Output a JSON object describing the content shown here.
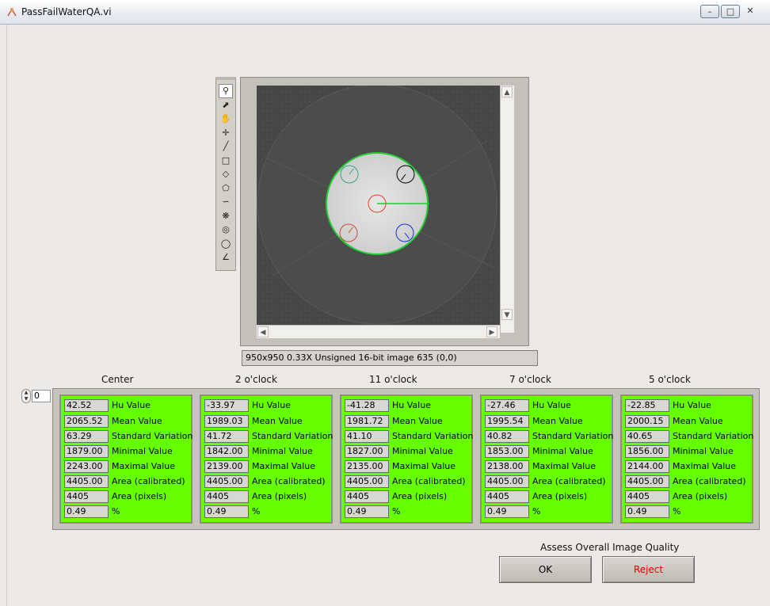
{
  "window": {
    "title": "PassFailWaterQA.vi"
  },
  "image_display": {
    "status": "950x950 0.33X Unsigned 16-bit image 635    (0,0)",
    "tools": [
      "zoom-icon",
      "pointer-icon",
      "pan-icon",
      "point-icon",
      "line-icon",
      "rectangle-icon",
      "rotated-rectangle-icon",
      "polygon-icon",
      "freehand-icon",
      "free-region-icon",
      "annulus-icon",
      "oval-icon",
      "broken-line-icon"
    ]
  },
  "index": {
    "value": "0"
  },
  "metric_labels": [
    "Hu Value",
    "Mean Value",
    "Standard Variation",
    "Minimal Value",
    "Maximal Value",
    "Area (calibrated)",
    "Area (pixels)",
    "%"
  ],
  "regions": [
    {
      "name": "Center",
      "color": "#ff3b1f",
      "values": [
        "42.52",
        "2065.52",
        "63.29",
        "1879.00",
        "2243.00",
        "4405.00",
        "4405",
        "0.49"
      ]
    },
    {
      "name": "2 o'clock",
      "color": "#000000",
      "values": [
        "-33.97",
        "1989.03",
        "41.72",
        "1842.00",
        "2139.00",
        "4405.00",
        "4405",
        "0.49"
      ]
    },
    {
      "name": "11 o'clock",
      "color": "#3aa28a",
      "values": [
        "-41.28",
        "1981.72",
        "41.10",
        "1827.00",
        "2135.00",
        "4405.00",
        "4405",
        "0.49"
      ]
    },
    {
      "name": "7 o'clock",
      "color": "#c94a3a",
      "values": [
        "-27.46",
        "1995.54",
        "40.82",
        "1853.00",
        "2138.00",
        "4405.00",
        "4405",
        "0.49"
      ]
    },
    {
      "name": "5 o'clock",
      "color": "#1a2fd6",
      "values": [
        "-22.85",
        "2000.15",
        "40.65",
        "1856.00",
        "2144.00",
        "4405.00",
        "4405",
        "0.49"
      ]
    }
  ],
  "actions": {
    "prompt": "Assess Overall Image Quality",
    "ok_label": "OK",
    "reject_label": "Reject"
  },
  "colors": {
    "panel_bg": "#66ff00",
    "roi_outline": "#22cc33",
    "reject_text": "#e00000"
  }
}
